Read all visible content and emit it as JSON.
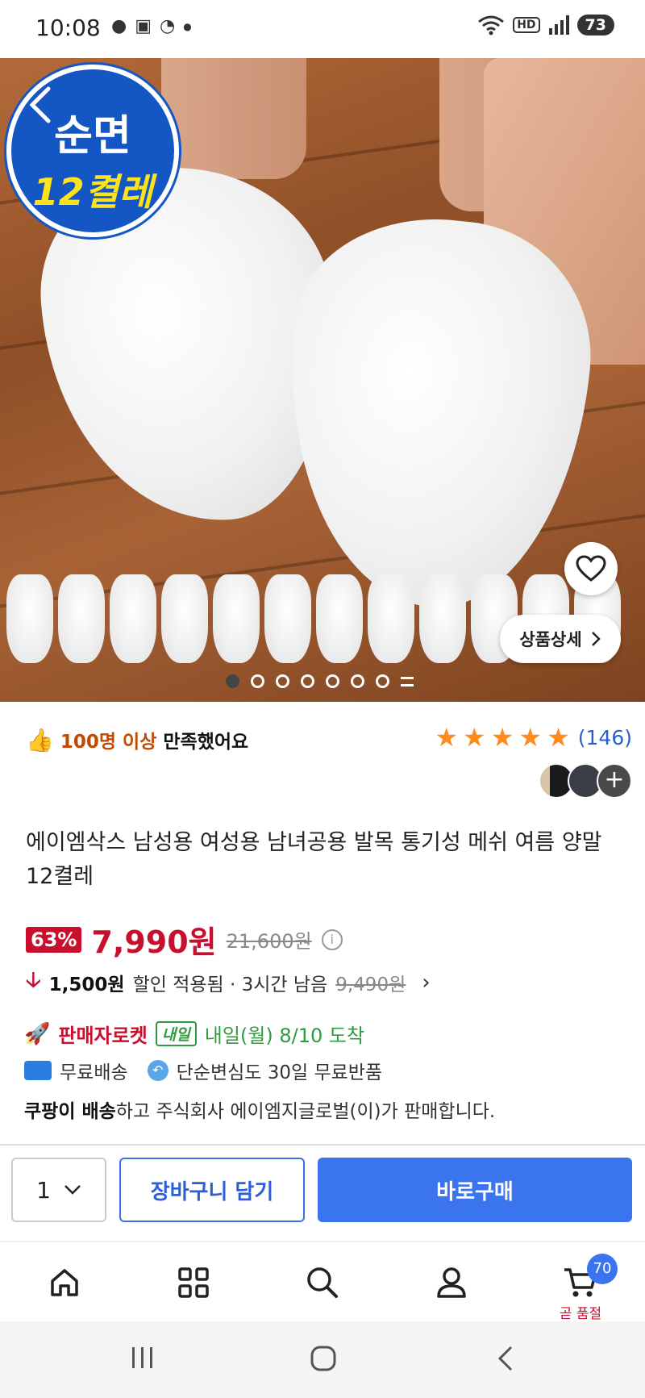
{
  "status": {
    "time": "10:08",
    "left_icons": [
      "notification-icon",
      "headset-icon",
      "bowl-icon",
      "dot-icon"
    ],
    "hd_label": "HD",
    "battery": "73"
  },
  "hero": {
    "badge_top": "순면",
    "badge_bottom": "12켤레",
    "detail_button": "상품상세",
    "carousel_count": 8,
    "carousel_active": 0
  },
  "satisfaction": {
    "highlight": "100명 이상",
    "rest": "만족했어요"
  },
  "rating": {
    "stars": 5,
    "review_count": "(146)"
  },
  "product": {
    "title": "에이엠삭스 남성용 여성용 남녀공용 발목 통기성 메쉬 여름 양말 12켤레"
  },
  "price": {
    "discount": "63%",
    "current": "7,990원",
    "original": "21,600원"
  },
  "coupon": {
    "amount": "1,500원",
    "text": "할인 적용됨 · 3시간 남음",
    "strike": "9,490원"
  },
  "delivery": {
    "rocket_label": "판매자로켓",
    "tomorrow_tag": "내일",
    "arrival": "내일(월) 8/10 도착"
  },
  "shipping": {
    "free_shipping": "무료배송",
    "return_policy": "단순변심도 30일 무료반품"
  },
  "seller": {
    "bold": "쿠팡이 배송",
    "rest": "하고 주식회사 에이엠지글로벌(이)가 판매합니다."
  },
  "action_bar": {
    "quantity": "1",
    "cart_button": "장바구니 담기",
    "buy_button": "바로구매"
  },
  "tab_bar": {
    "cart_badge": "70",
    "cart_caption": "곧 품절"
  },
  "colors": {
    "accent_red": "#c8102e",
    "accent_blue": "#3b74ef",
    "star_orange": "#ff8a1e",
    "green": "#2e9c3e"
  }
}
